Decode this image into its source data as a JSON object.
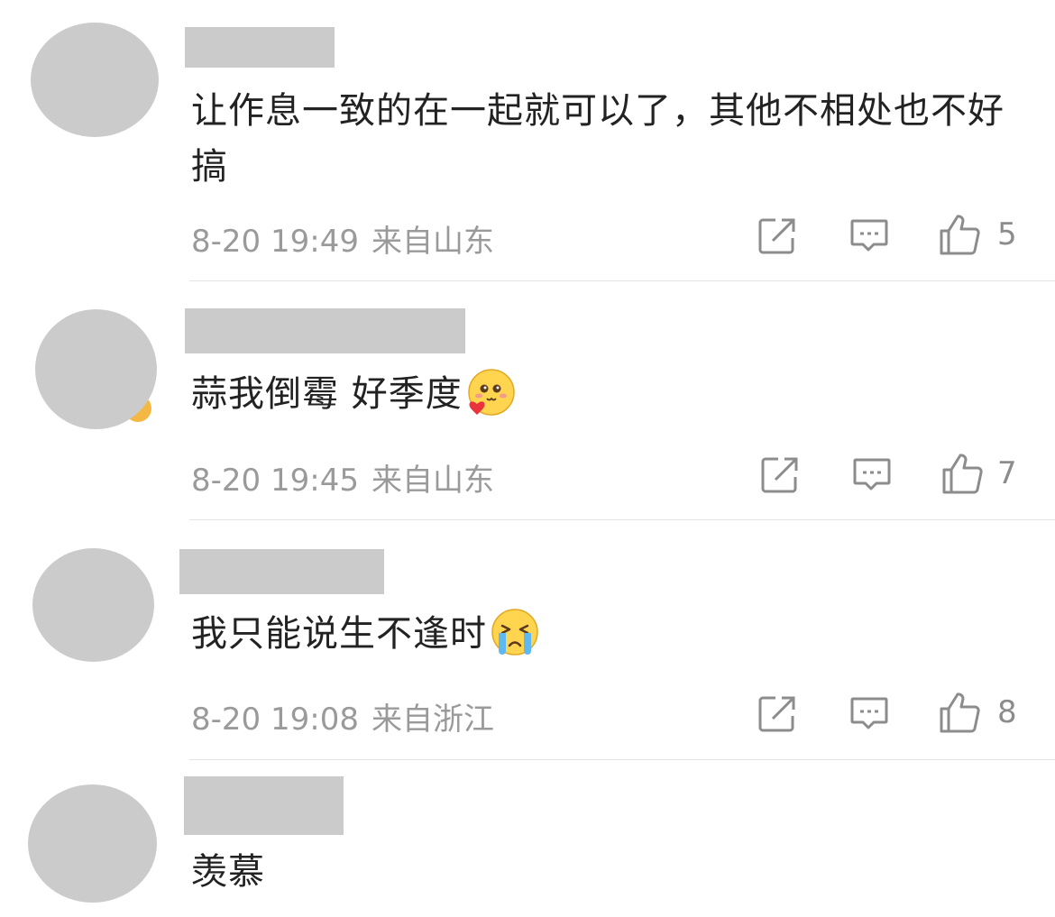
{
  "comments": [
    {
      "text": "让作息一致的在一起就可以了，其他不相处也不好搞",
      "date": "8-20 19:49",
      "location": "来自山东",
      "likes": "5",
      "emoji": ""
    },
    {
      "text": "蒜我倒霉 好季度",
      "date": "8-20 19:45",
      "location": "来自山东",
      "likes": "7",
      "emoji": "heart-eyes-emoji"
    },
    {
      "text": "我只能说生不逢时",
      "date": "8-20 19:08",
      "location": "来自浙江",
      "likes": "8",
      "emoji": "crying-emoji"
    },
    {
      "text": "羡慕",
      "date": "",
      "location": "",
      "likes": "",
      "emoji": ""
    }
  ],
  "icons": {
    "share": "share-icon",
    "reply": "comment-icon",
    "like": "thumbs-up-icon"
  },
  "colors": {
    "text": "#222222",
    "meta": "#9a9a9a",
    "placeholder": "#cbcbcb",
    "divider": "#e3e3e3"
  }
}
